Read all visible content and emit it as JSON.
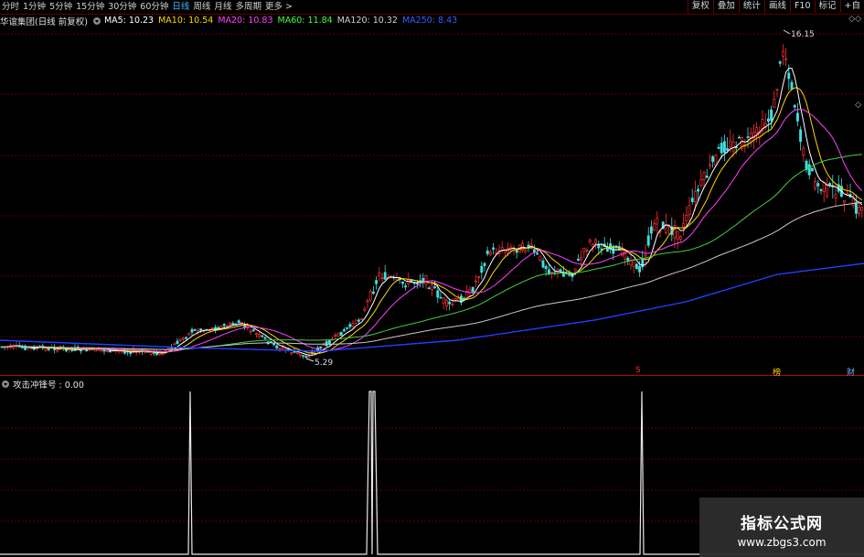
{
  "toolbar": {
    "periods": [
      "分时",
      "1分钟",
      "5分钟",
      "15分钟",
      "30分钟",
      "60分钟",
      "日线",
      "周线",
      "月线",
      "多周期",
      "更多 >"
    ],
    "active_period": "日线",
    "right_buttons": [
      "复权",
      "叠加",
      "统计",
      "画线",
      "F10",
      "标记",
      "+自"
    ]
  },
  "info": {
    "stock": "华谊集团(日线 前复权)",
    "ma": [
      {
        "label": "MA5: 10.23",
        "color": "#ffffff"
      },
      {
        "label": "MA10: 10.54",
        "color": "#ffd700"
      },
      {
        "label": "MA20: 10.83",
        "color": "#ff40ff"
      },
      {
        "label": "MA60: 11.84",
        "color": "#40ff40"
      },
      {
        "label": "MA120: 10.32",
        "color": "#d0d0d0"
      },
      {
        "label": "MA250: 8.43",
        "color": "#3060ff"
      }
    ]
  },
  "price_chart": {
    "high_label": "16.15",
    "low_label": "5.29"
  },
  "indicator": {
    "name": "攻击冲锋号 : 0.00"
  },
  "markers": [
    {
      "text": "S",
      "color": "#ff3030"
    },
    {
      "text": "榜",
      "color": "#ffcc00"
    },
    {
      "text": "财",
      "color": "#6fb0ff"
    }
  ],
  "watermark": {
    "title": "指标公式网",
    "url": "www.zbgs3.com"
  },
  "colors": {
    "up": "#ff3030",
    "down": "#40e0e0",
    "grid": "#5a0000",
    "accent": "#3fb6ff",
    "separator": "#c00000"
  }
}
